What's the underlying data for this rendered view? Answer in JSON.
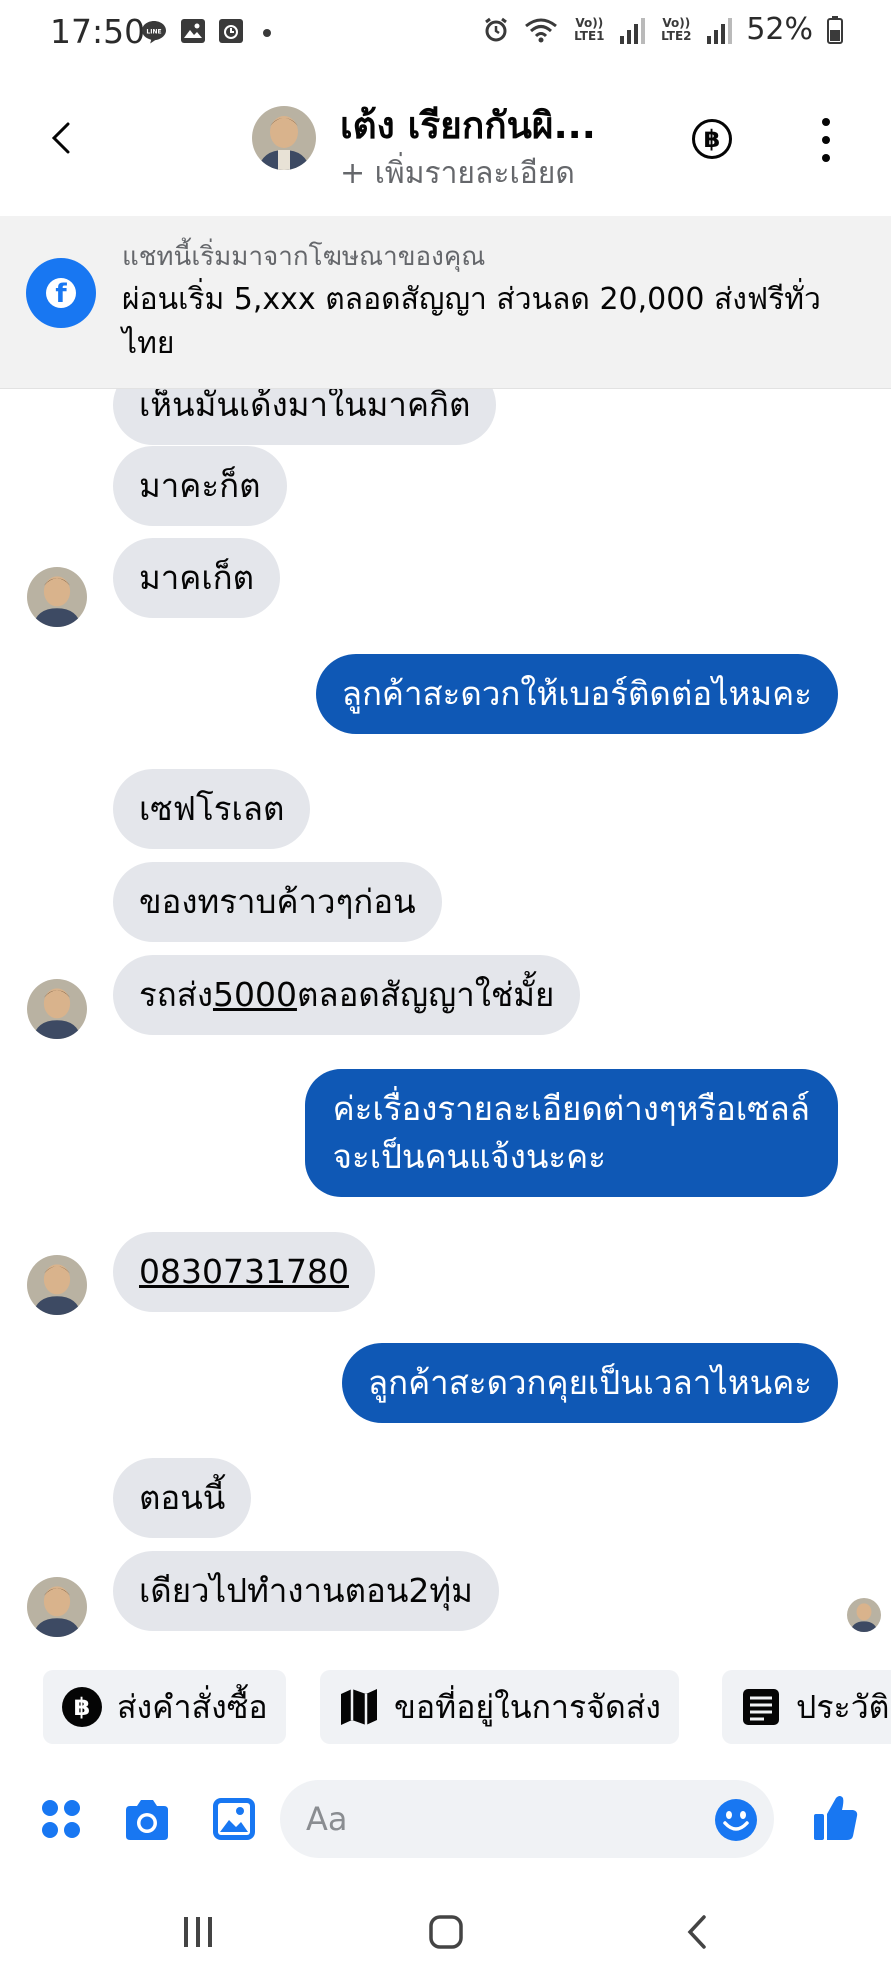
{
  "status_bar": {
    "time": "17:50",
    "notification_icons": [
      "line-icon",
      "gallery-icon",
      "screen-recorder-icon",
      "dot-icon"
    ],
    "network_1": "Vo)) LTE1",
    "network_2": "Vo)) LTE2",
    "battery": "52%"
  },
  "header": {
    "contact_name": "เต้ง เรียกกันผิ...",
    "subtitle": "+ เพิ่มรายละเอียด",
    "baht_symbol": "฿"
  },
  "ad_banner": {
    "label": "แชทนี้เริ่มมาจากโฆษณาของคุณ",
    "text": "ผ่อนเริ่ม 5,xxx ตลอดสัญญา ส่วนลด 20,000 ส่งฟรีทั่วไทย"
  },
  "messages": [
    {
      "from": "contact",
      "text": "เห็นมันเด้งมาในมาคกิต"
    },
    {
      "from": "contact",
      "text": "มาคะก็ต"
    },
    {
      "from": "contact",
      "text": "มาคเก็ต"
    },
    {
      "from": "me",
      "text": "ลูกค้าสะดวกให้เบอร์ติดต่อไหมคะ"
    },
    {
      "from": "contact",
      "text": "เซฟโรเลต"
    },
    {
      "from": "contact",
      "text": "ของทราบค้าวๆก่อน"
    },
    {
      "from": "contact",
      "text_before": "รถส่ง",
      "text_link": "5000",
      "text_after": "ตลอดสัญญาใช่มั้ย"
    },
    {
      "from": "me",
      "line1": "ค่ะเรื่องรายละเอียดต่างๆหรือเซลล์",
      "line2": "จะเป็นคนแจ้งนะคะ"
    },
    {
      "from": "contact",
      "text": "0830731780"
    },
    {
      "from": "me",
      "text": "ลูกค้าสะดวกคุยเป็นเวลาไหนคะ"
    },
    {
      "from": "contact",
      "text": "ตอนนี้"
    },
    {
      "from": "contact",
      "text": "เดียวไปทำงานตอน2ทุ่ม"
    }
  ],
  "quick_replies": [
    {
      "label": "ส่งคำสั่งซื้อ",
      "icon": "baht-icon"
    },
    {
      "label": "ขอที่อยู่ในการจัดส่ง",
      "icon": "map-icon"
    },
    {
      "label": "ประวัติ",
      "icon": "receipt-icon"
    }
  ],
  "composer": {
    "placeholder": "Aa",
    "icons": [
      "menu-grid-icon",
      "camera-icon",
      "gallery-icon",
      "emoji-icon",
      "thumbs-up-icon"
    ]
  },
  "colors": {
    "outgoing_bubble": "#0f58b5",
    "incoming_bubble": "#e4e6eb",
    "accent": "#1877f2",
    "banner_bg": "#f2f2f2"
  }
}
